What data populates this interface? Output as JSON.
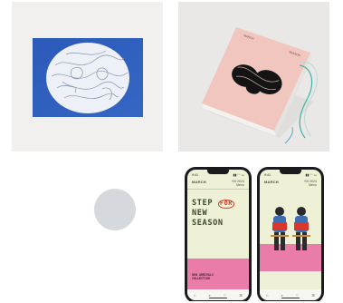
{
  "tiles": [
    {
      "name": "Blue print artwork"
    },
    {
      "name": "Pink book cover"
    },
    {
      "name": "Loading placeholder"
    },
    {
      "name": "Mobile app mockups"
    }
  ],
  "book": {
    "cover_text_left": "MARCH",
    "cover_text_right": "SEASON"
  },
  "phone_left": {
    "status_time": "9:41",
    "status_icons": "▮▮ ◠ ▭",
    "brand": "MARCH",
    "nav_right_1": "SS 2024",
    "nav_right_2": "Menu",
    "line1": "STEP",
    "for_word": "FOR",
    "line2": "NEW",
    "line3": "SEASON",
    "pink_line1": "NEW ARRIVALS",
    "pink_line2": "COLLECTION",
    "tabs": [
      "⌂",
      "⌕",
      "♡",
      "☰"
    ]
  },
  "phone_right": {
    "status_time": "9:41",
    "status_icons": "▮▮ ◠ ▭",
    "brand": "MARCH",
    "nav_right_1": "SS 2024",
    "nav_right_2": "Menu",
    "tabs": [
      "⌂",
      "⌕",
      "♡",
      "☰"
    ]
  },
  "colors": {
    "print_blue": "#2f5fbf",
    "book_pink": "#f0c6bf",
    "phone_bg": "#eef1d6",
    "accent_red": "#cf3f2a",
    "band_pink": "#e97ca8"
  }
}
